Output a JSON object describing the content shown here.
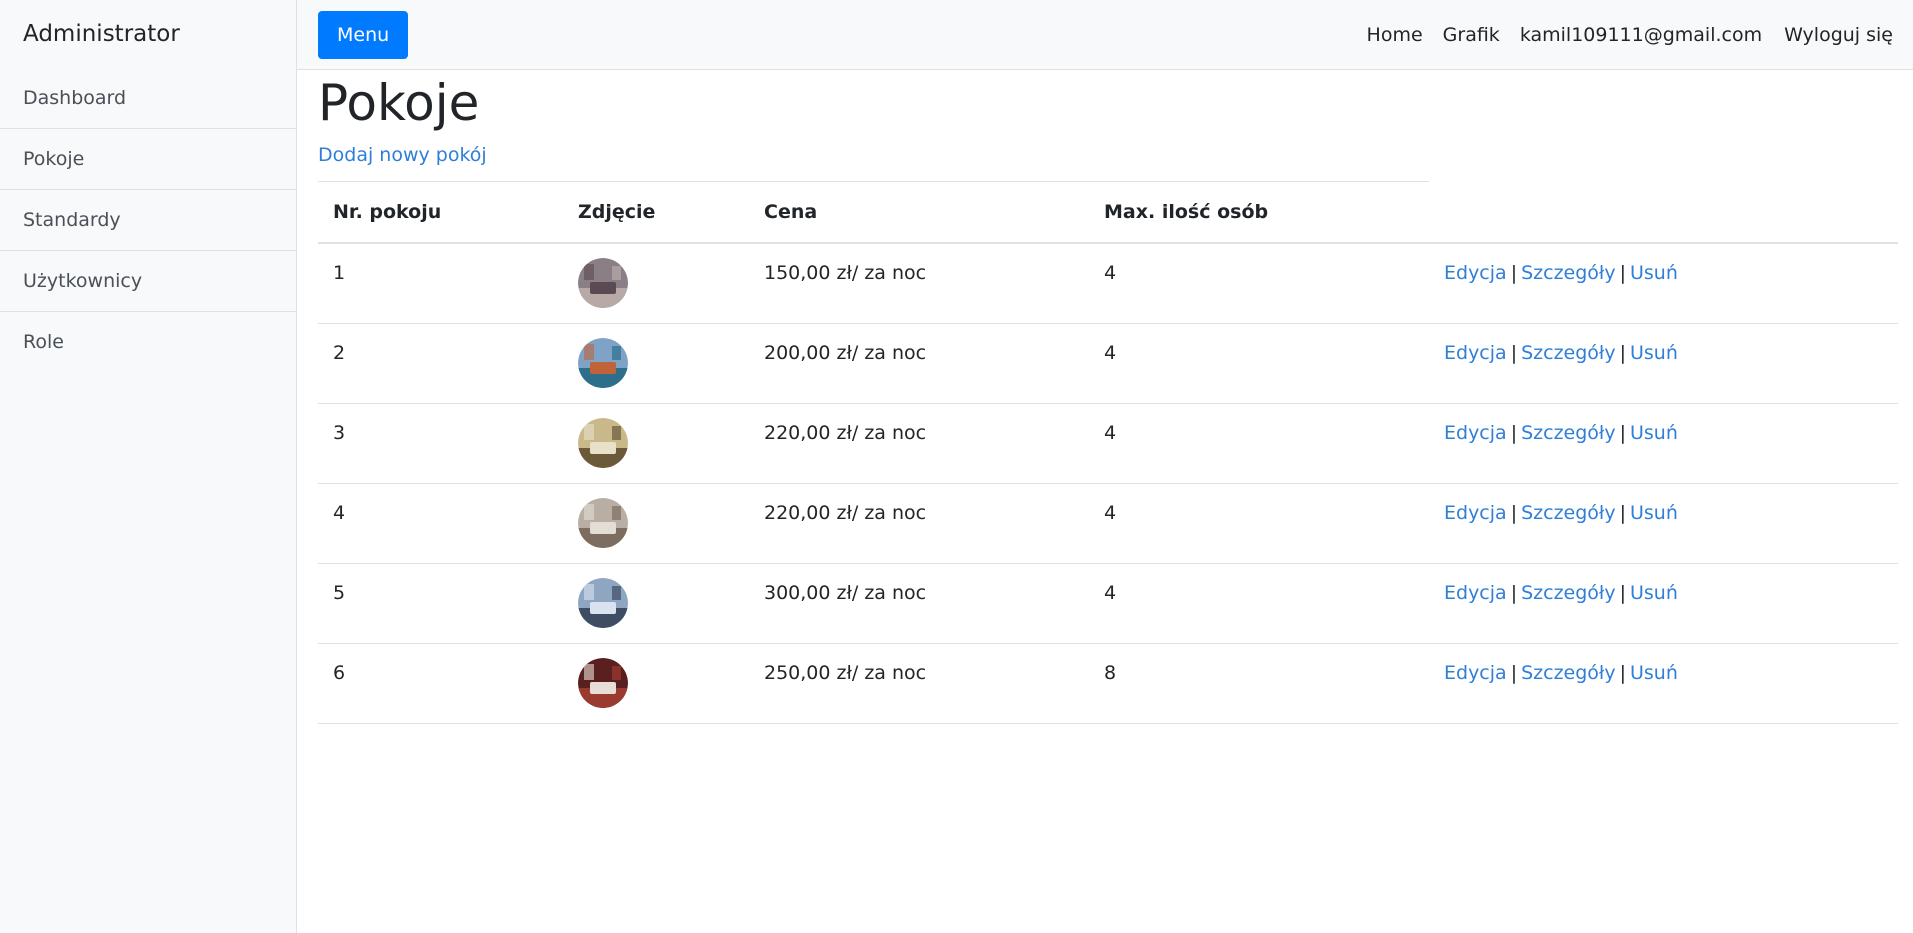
{
  "sidebar": {
    "heading": "Administrator",
    "items": [
      {
        "label": "Dashboard"
      },
      {
        "label": "Pokoje"
      },
      {
        "label": "Standardy"
      },
      {
        "label": "Użytkownicy"
      },
      {
        "label": "Role"
      }
    ]
  },
  "topbar": {
    "menu_label": "Menu",
    "nav": {
      "home": "Home",
      "grafik": "Grafik",
      "email": "kamil109111@gmail.com",
      "logout": "Wyloguj się"
    }
  },
  "page": {
    "title": "Pokoje",
    "add_link": "Dodaj nowy pokój"
  },
  "table": {
    "headers": {
      "nr": "Nr. pokoju",
      "photo": "Zdjęcie",
      "price": "Cena",
      "max": "Max. ilość osób"
    },
    "actions": {
      "edit": "Edycja",
      "details": "Szczegóły",
      "delete": "Usuń",
      "separator": "|"
    },
    "rows": [
      {
        "nr": "1",
        "price": "150,00 zł/ za noc",
        "max": "4",
        "photo_colors": [
          "#8a7f86",
          "#5c4a52",
          "#b7a9a6"
        ]
      },
      {
        "nr": "2",
        "price": "200,00 zł/ za noc",
        "max": "4",
        "photo_colors": [
          "#7fa3c7",
          "#c0623a",
          "#2d6f8a"
        ]
      },
      {
        "nr": "3",
        "price": "220,00 zł/ za noc",
        "max": "4",
        "photo_colors": [
          "#c9b98a",
          "#e8e0c8",
          "#6b5a3a"
        ]
      },
      {
        "nr": "4",
        "price": "220,00 zł/ za noc",
        "max": "4",
        "photo_colors": [
          "#b9aea3",
          "#e3ddd6",
          "#7d6d60"
        ]
      },
      {
        "nr": "5",
        "price": "300,00 zł/ za noc",
        "max": "4",
        "photo_colors": [
          "#8fa6c2",
          "#d9e2ee",
          "#3e4d63"
        ]
      },
      {
        "nr": "6",
        "price": "250,00 zł/ za noc",
        "max": "8",
        "photo_colors": [
          "#5a1f1f",
          "#e8ded8",
          "#9b3a2e"
        ]
      }
    ]
  }
}
